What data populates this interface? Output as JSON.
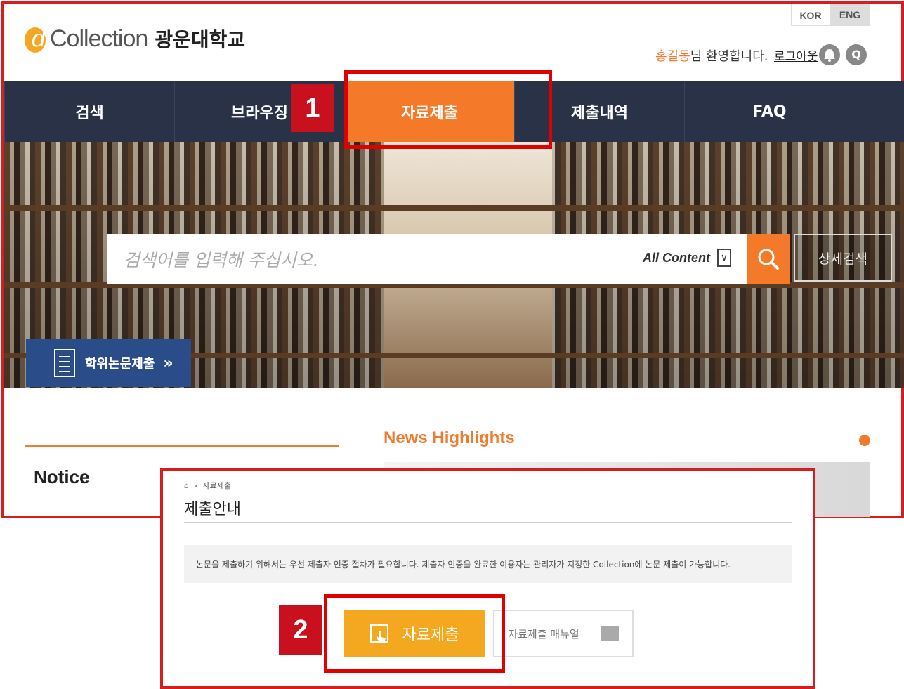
{
  "header": {
    "logo_mark": "d",
    "logo_word": "Collection",
    "university": "광운대학교",
    "lang_kor": "KOR",
    "lang_eng": "ENG",
    "user_name": "홍길동",
    "welcome_suffix": "님 환영합니다.",
    "logout": "로그아웃",
    "q_icon_label": "Q"
  },
  "nav": {
    "items": [
      {
        "label": "검색"
      },
      {
        "label": "브라우징"
      },
      {
        "label": "자료제출"
      },
      {
        "label": "제출내역"
      },
      {
        "label": "FAQ"
      }
    ],
    "active_index": 2
  },
  "search": {
    "placeholder": "검색어를 입력해 주십시오.",
    "scope": "All Content",
    "dropdown_arrow": "∨",
    "advanced": "상세검색"
  },
  "thesis_button": {
    "label": "학위논문제출",
    "arrow": "»"
  },
  "sections": {
    "notice": "Notice",
    "news": "News Highlights"
  },
  "submission_page": {
    "breadcrumb_sep": "›",
    "breadcrumb_current": "자료제출",
    "title": "제출안내",
    "info": "논문을 제출하기 위해서는 우선 제출자 인증 절차가 필요합니다. 제출자 인증을 완료한 이용자는 관리자가 지정한 Collection에 논문 제출이 가능합니다.",
    "submit_label": "자료제출",
    "manual_label": "자료제출 매뉴얼"
  },
  "annotations": {
    "step1": "1",
    "step2": "2"
  },
  "colors": {
    "accent_orange": "#f47a2a",
    "nav_bg": "#2a3247",
    "submit_yellow": "#f4a81f",
    "highlight_red": "#e00000"
  }
}
